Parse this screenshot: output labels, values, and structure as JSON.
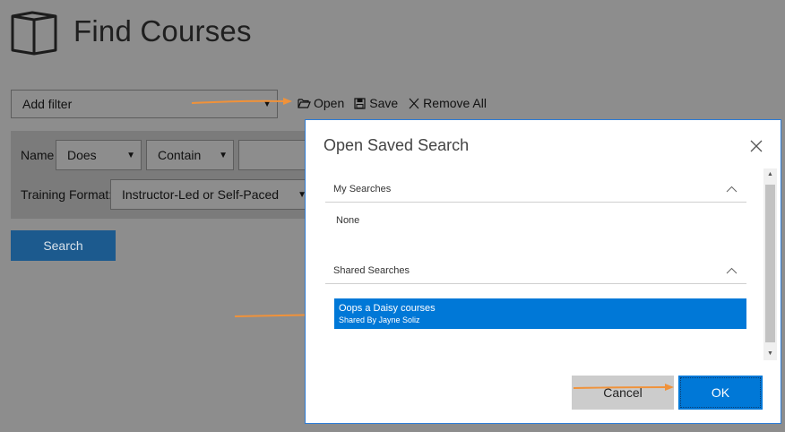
{
  "page": {
    "title": "Find Courses"
  },
  "filter": {
    "add_filter_label": "Add filter",
    "name_label": "Name",
    "name_operator_1": "Does",
    "name_operator_2": "Contain",
    "training_format_label": "Training Format:",
    "training_format_value": "Instructor-Led or Self-Paced"
  },
  "toolbar": {
    "open_label": "Open",
    "save_label": "Save",
    "remove_all_label": "Remove All"
  },
  "search_button_label": "Search",
  "modal": {
    "title": "Open Saved Search",
    "my_searches": {
      "header": "My Searches",
      "empty_text": "None"
    },
    "shared_searches": {
      "header": "Shared Searches",
      "items": [
        {
          "name": "Oops a Daisy courses",
          "shared_by": "Shared By Jayne Soliz"
        }
      ]
    },
    "cancel_label": "Cancel",
    "ok_label": "OK"
  },
  "colors": {
    "overlay_background": "#8d8d8d",
    "accent_blue": "#0078d7",
    "annotation_arrow": "#f0923a"
  },
  "icons": [
    "book-icon",
    "folder-open-icon",
    "floppy-disk-icon",
    "close-icon",
    "chevron-up-icon",
    "chevron-down-icon",
    "arrow-up-icon",
    "arrow-down-icon"
  ]
}
